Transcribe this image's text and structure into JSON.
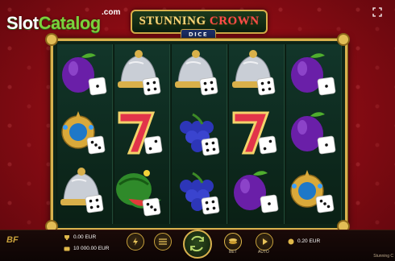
{
  "brand": {
    "name_part1": "Slot",
    "name_part2": "Catalog",
    "suffix": ".com"
  },
  "title": {
    "word1": "STUNNING",
    "word2": "CROWN",
    "subtitle": "DICE"
  },
  "reels": [
    [
      "plum",
      "bell",
      "bell",
      "bell",
      "plum"
    ],
    [
      "crown",
      "seven",
      "grapes",
      "seven",
      "plum"
    ],
    [
      "bell",
      "watermelon",
      "grapes",
      "plum",
      "crown"
    ]
  ],
  "balance": {
    "win_value": "0.00 EUR",
    "balance_value": "10 000.00 EUR"
  },
  "bet": {
    "bet_label": "BET",
    "bet_value": "0.20 EUR"
  },
  "controls": {
    "auto_label": "AUTO"
  },
  "provider": "BF",
  "game_name": "Stunning C",
  "colors": {
    "accent_gold": "#d8b14e",
    "background_red": "#a3101a",
    "reel_bg": "#0c2417"
  }
}
